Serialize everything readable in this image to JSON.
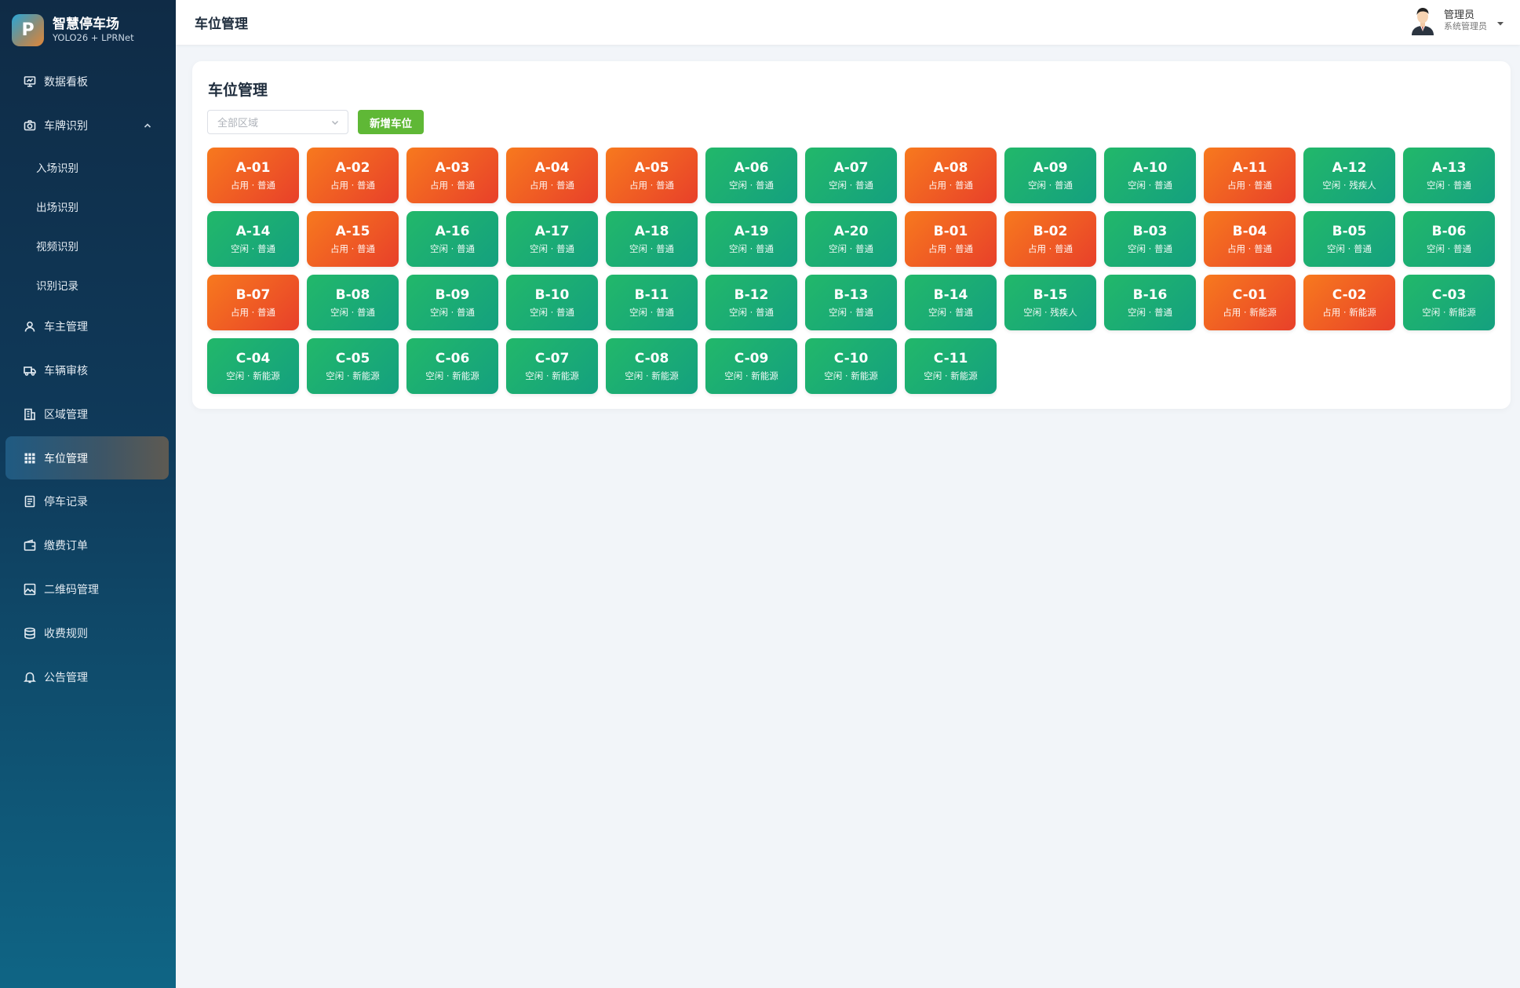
{
  "brand": {
    "logo_letter": "P",
    "title": "智慧停车场",
    "subtitle": "YOLO26 + LPRNet"
  },
  "sidebar": {
    "items": [
      {
        "label": "数据看板",
        "icon": "monitor-icon"
      },
      {
        "label": "车牌识别",
        "icon": "camera-icon",
        "expanded": true,
        "children": [
          {
            "label": "入场识别"
          },
          {
            "label": "出场识别"
          },
          {
            "label": "视频识别"
          },
          {
            "label": "识别记录"
          }
        ]
      },
      {
        "label": "车主管理",
        "icon": "user-icon"
      },
      {
        "label": "车辆审核",
        "icon": "truck-icon"
      },
      {
        "label": "区域管理",
        "icon": "building-icon"
      },
      {
        "label": "车位管理",
        "icon": "grid-icon",
        "active": true
      },
      {
        "label": "停车记录",
        "icon": "document-icon"
      },
      {
        "label": "缴费订单",
        "icon": "wallet-icon"
      },
      {
        "label": "二维码管理",
        "icon": "image-icon"
      },
      {
        "label": "收费规则",
        "icon": "database-icon"
      },
      {
        "label": "公告管理",
        "icon": "bell-icon"
      }
    ]
  },
  "header": {
    "title": "车位管理",
    "user_name": "管理员",
    "user_role": "系统管理员"
  },
  "main": {
    "title": "车位管理",
    "area_select_placeholder": "全部区域",
    "add_button": "新增车位",
    "colors": {
      "occupied": "#e8402a",
      "free": "#14a07f",
      "add_button": "#5fb836"
    },
    "slots": [
      {
        "code": "A-01",
        "desc": "占用 · 普通",
        "status": "occupied"
      },
      {
        "code": "A-02",
        "desc": "占用 · 普通",
        "status": "occupied"
      },
      {
        "code": "A-03",
        "desc": "占用 · 普通",
        "status": "occupied"
      },
      {
        "code": "A-04",
        "desc": "占用 · 普通",
        "status": "occupied"
      },
      {
        "code": "A-05",
        "desc": "占用 · 普通",
        "status": "occupied"
      },
      {
        "code": "A-06",
        "desc": "空闲 · 普通",
        "status": "free"
      },
      {
        "code": "A-07",
        "desc": "空闲 · 普通",
        "status": "free"
      },
      {
        "code": "A-08",
        "desc": "占用 · 普通",
        "status": "occupied"
      },
      {
        "code": "A-09",
        "desc": "空闲 · 普通",
        "status": "free"
      },
      {
        "code": "A-10",
        "desc": "空闲 · 普通",
        "status": "free"
      },
      {
        "code": "A-11",
        "desc": "占用 · 普通",
        "status": "occupied"
      },
      {
        "code": "A-12",
        "desc": "空闲 · 残疾人",
        "status": "free"
      },
      {
        "code": "A-13",
        "desc": "空闲 · 普通",
        "status": "free"
      },
      {
        "code": "A-14",
        "desc": "空闲 · 普通",
        "status": "free"
      },
      {
        "code": "A-15",
        "desc": "占用 · 普通",
        "status": "occupied"
      },
      {
        "code": "A-16",
        "desc": "空闲 · 普通",
        "status": "free"
      },
      {
        "code": "A-17",
        "desc": "空闲 · 普通",
        "status": "free"
      },
      {
        "code": "A-18",
        "desc": "空闲 · 普通",
        "status": "free"
      },
      {
        "code": "A-19",
        "desc": "空闲 · 普通",
        "status": "free"
      },
      {
        "code": "A-20",
        "desc": "空闲 · 普通",
        "status": "free"
      },
      {
        "code": "B-01",
        "desc": "占用 · 普通",
        "status": "occupied"
      },
      {
        "code": "B-02",
        "desc": "占用 · 普通",
        "status": "occupied"
      },
      {
        "code": "B-03",
        "desc": "空闲 · 普通",
        "status": "free"
      },
      {
        "code": "B-04",
        "desc": "占用 · 普通",
        "status": "occupied"
      },
      {
        "code": "B-05",
        "desc": "空闲 · 普通",
        "status": "free"
      },
      {
        "code": "B-06",
        "desc": "空闲 · 普通",
        "status": "free"
      },
      {
        "code": "B-07",
        "desc": "占用 · 普通",
        "status": "occupied"
      },
      {
        "code": "B-08",
        "desc": "空闲 · 普通",
        "status": "free"
      },
      {
        "code": "B-09",
        "desc": "空闲 · 普通",
        "status": "free"
      },
      {
        "code": "B-10",
        "desc": "空闲 · 普通",
        "status": "free"
      },
      {
        "code": "B-11",
        "desc": "空闲 · 普通",
        "status": "free"
      },
      {
        "code": "B-12",
        "desc": "空闲 · 普通",
        "status": "free"
      },
      {
        "code": "B-13",
        "desc": "空闲 · 普通",
        "status": "free"
      },
      {
        "code": "B-14",
        "desc": "空闲 · 普通",
        "status": "free"
      },
      {
        "code": "B-15",
        "desc": "空闲 · 残疾人",
        "status": "free"
      },
      {
        "code": "B-16",
        "desc": "空闲 · 普通",
        "status": "free"
      },
      {
        "code": "C-01",
        "desc": "占用 · 新能源",
        "status": "occupied"
      },
      {
        "code": "C-02",
        "desc": "占用 · 新能源",
        "status": "occupied"
      },
      {
        "code": "C-03",
        "desc": "空闲 · 新能源",
        "status": "free"
      },
      {
        "code": "C-04",
        "desc": "空闲 · 新能源",
        "status": "free"
      },
      {
        "code": "C-05",
        "desc": "空闲 · 新能源",
        "status": "free"
      },
      {
        "code": "C-06",
        "desc": "空闲 · 新能源",
        "status": "free"
      },
      {
        "code": "C-07",
        "desc": "空闲 · 新能源",
        "status": "free"
      },
      {
        "code": "C-08",
        "desc": "空闲 · 新能源",
        "status": "free"
      },
      {
        "code": "C-09",
        "desc": "空闲 · 新能源",
        "status": "free"
      },
      {
        "code": "C-10",
        "desc": "空闲 · 新能源",
        "status": "free"
      },
      {
        "code": "C-11",
        "desc": "空闲 · 新能源",
        "status": "free"
      }
    ]
  }
}
